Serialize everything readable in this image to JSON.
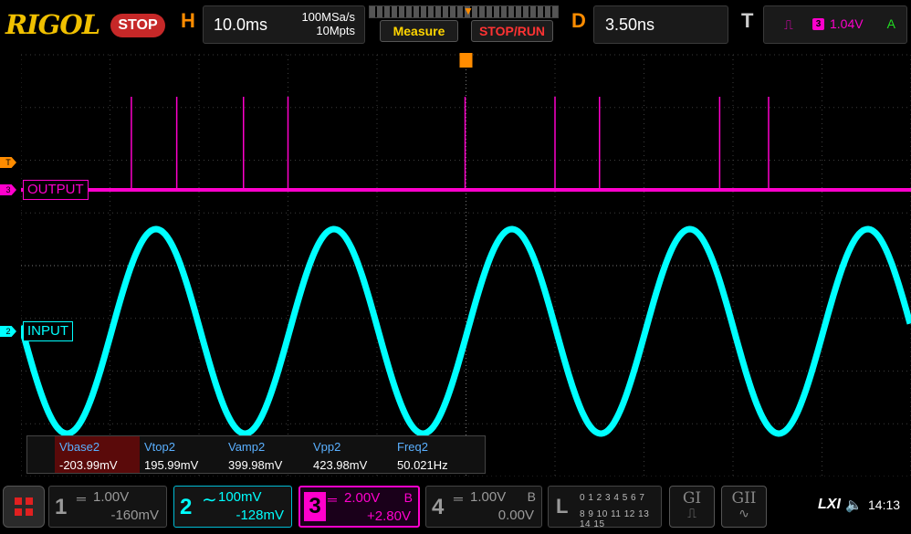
{
  "brand": "RIGOL",
  "run_state": "STOP",
  "horizontal": {
    "letter": "H",
    "timebase": "10.0ms",
    "sample_rate": "100MSa/s",
    "memory_depth": "10Mpts"
  },
  "buttons": {
    "measure": "Measure",
    "stop_run": "STOP/RUN"
  },
  "delay": {
    "letter": "D",
    "value": "3.50ns"
  },
  "trigger": {
    "letter": "T",
    "edge_symbol": "⏚",
    "source": "3",
    "level": "1.04V",
    "mode": "A",
    "marker": "T"
  },
  "channel_labels": {
    "output": "OUTPUT",
    "input": "INPUT",
    "ch3_marker": "3",
    "ch2_marker": "2",
    "trig_marker": "T"
  },
  "measurements": [
    {
      "name": "Vbase2",
      "value": "-203.99mV"
    },
    {
      "name": "Vtop2",
      "value": "195.99mV"
    },
    {
      "name": "Vamp2",
      "value": "399.98mV"
    },
    {
      "name": "Vpp2",
      "value": "423.98mV"
    },
    {
      "name": "Freq2",
      "value": "50.021Hz"
    }
  ],
  "channels": [
    {
      "num": "1",
      "coupling": "═",
      "scale": "1.00V",
      "offset": "-160mV",
      "bw": ""
    },
    {
      "num": "2",
      "coupling": "∼",
      "scale": "100mV",
      "offset": "-128mV",
      "bw": ""
    },
    {
      "num": "3",
      "coupling": "═",
      "scale": "2.00V",
      "offset": "+2.80V",
      "bw": "B"
    },
    {
      "num": "4",
      "coupling": "═",
      "scale": "1.00V",
      "offset": "0.00V",
      "bw": "B"
    }
  ],
  "logic": {
    "letter": "L",
    "row1": "0 1 2 3  4 5 6 7",
    "row2": "8 9 10 11 12 13 14 15"
  },
  "generators": [
    {
      "label": "GI"
    },
    {
      "label": "GII"
    }
  ],
  "status": {
    "lxi": "LXI",
    "speaker_icon": "speaker-icon",
    "clock": "14:13"
  },
  "colors": {
    "ch2": "#00ffff",
    "ch3": "#ff00cc",
    "accent": "#ff8c00",
    "brand": "#f0c000"
  },
  "waveform": {
    "input_frequency_hz": 50.021,
    "output_pulse_positions_ms": [
      -37.6,
      -32.5,
      -25.0,
      -20.0,
      -0.1,
      10.0,
      15.0,
      28.5,
      34.0
    ]
  }
}
